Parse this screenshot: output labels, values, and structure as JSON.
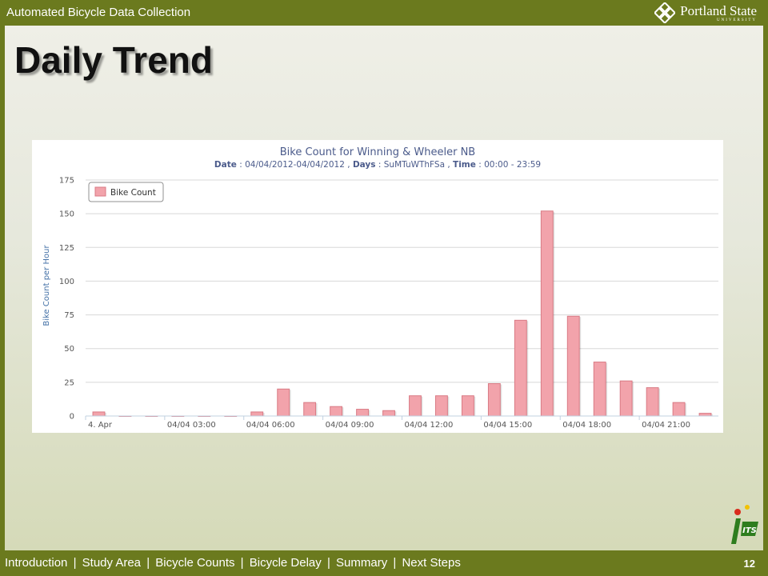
{
  "header": {
    "title": "Automated Bicycle Data Collection",
    "logo_name": "Portland State",
    "logo_sub": "UNIVERSITY"
  },
  "slide": {
    "heading": "Daily Trend",
    "page_number": "12"
  },
  "footer": {
    "nav": [
      {
        "label": "Introduction"
      },
      {
        "label": "Study Area"
      },
      {
        "label": "Bicycle Counts",
        "active": true
      },
      {
        "label": "Bicycle Delay"
      },
      {
        "label": "Summary"
      },
      {
        "label": "Next Steps"
      }
    ],
    "separator": "|",
    "its_logo": "ITS"
  },
  "colors": {
    "bar_fill": "#f2a3ab",
    "bar_stroke": "#d97a84",
    "title_color": "#4b5b8b",
    "axis_label_color": "#4572a7",
    "theme_green": "#6b7a1e"
  },
  "chart_data": {
    "type": "bar",
    "title": "Bike Count for Winning & Wheeler NB",
    "subtitle_parts": [
      {
        "label": "Date",
        "value": "04/04/2012-04/04/2012"
      },
      {
        "label": "Days",
        "value": "SuMTuWThFSa"
      },
      {
        "label": "Time",
        "value": "00:00 - 23:59"
      }
    ],
    "ylabel": "Bike Count per Hour",
    "ylim": [
      0,
      175
    ],
    "yticks": [
      0,
      25,
      50,
      75,
      100,
      125,
      150,
      175
    ],
    "grid": true,
    "legend": {
      "position": "top-left",
      "label": "Bike Count"
    },
    "x_tick_labels": [
      {
        "hour": 0,
        "label": "4. Apr"
      },
      {
        "hour": 3,
        "label": "04/04 03:00"
      },
      {
        "hour": 6,
        "label": "04/04 06:00"
      },
      {
        "hour": 9,
        "label": "04/04 09:00"
      },
      {
        "hour": 12,
        "label": "04/04 12:00"
      },
      {
        "hour": 15,
        "label": "04/04 15:00"
      },
      {
        "hour": 18,
        "label": "04/04 18:00"
      },
      {
        "hour": 21,
        "label": "04/04 21:00"
      }
    ],
    "series": [
      {
        "name": "Bike Count",
        "values": [
          3,
          0,
          0,
          0,
          0,
          0,
          3,
          20,
          10,
          7,
          5,
          4,
          15,
          15,
          15,
          24,
          71,
          152,
          74,
          40,
          26,
          21,
          10,
          2
        ]
      }
    ]
  }
}
